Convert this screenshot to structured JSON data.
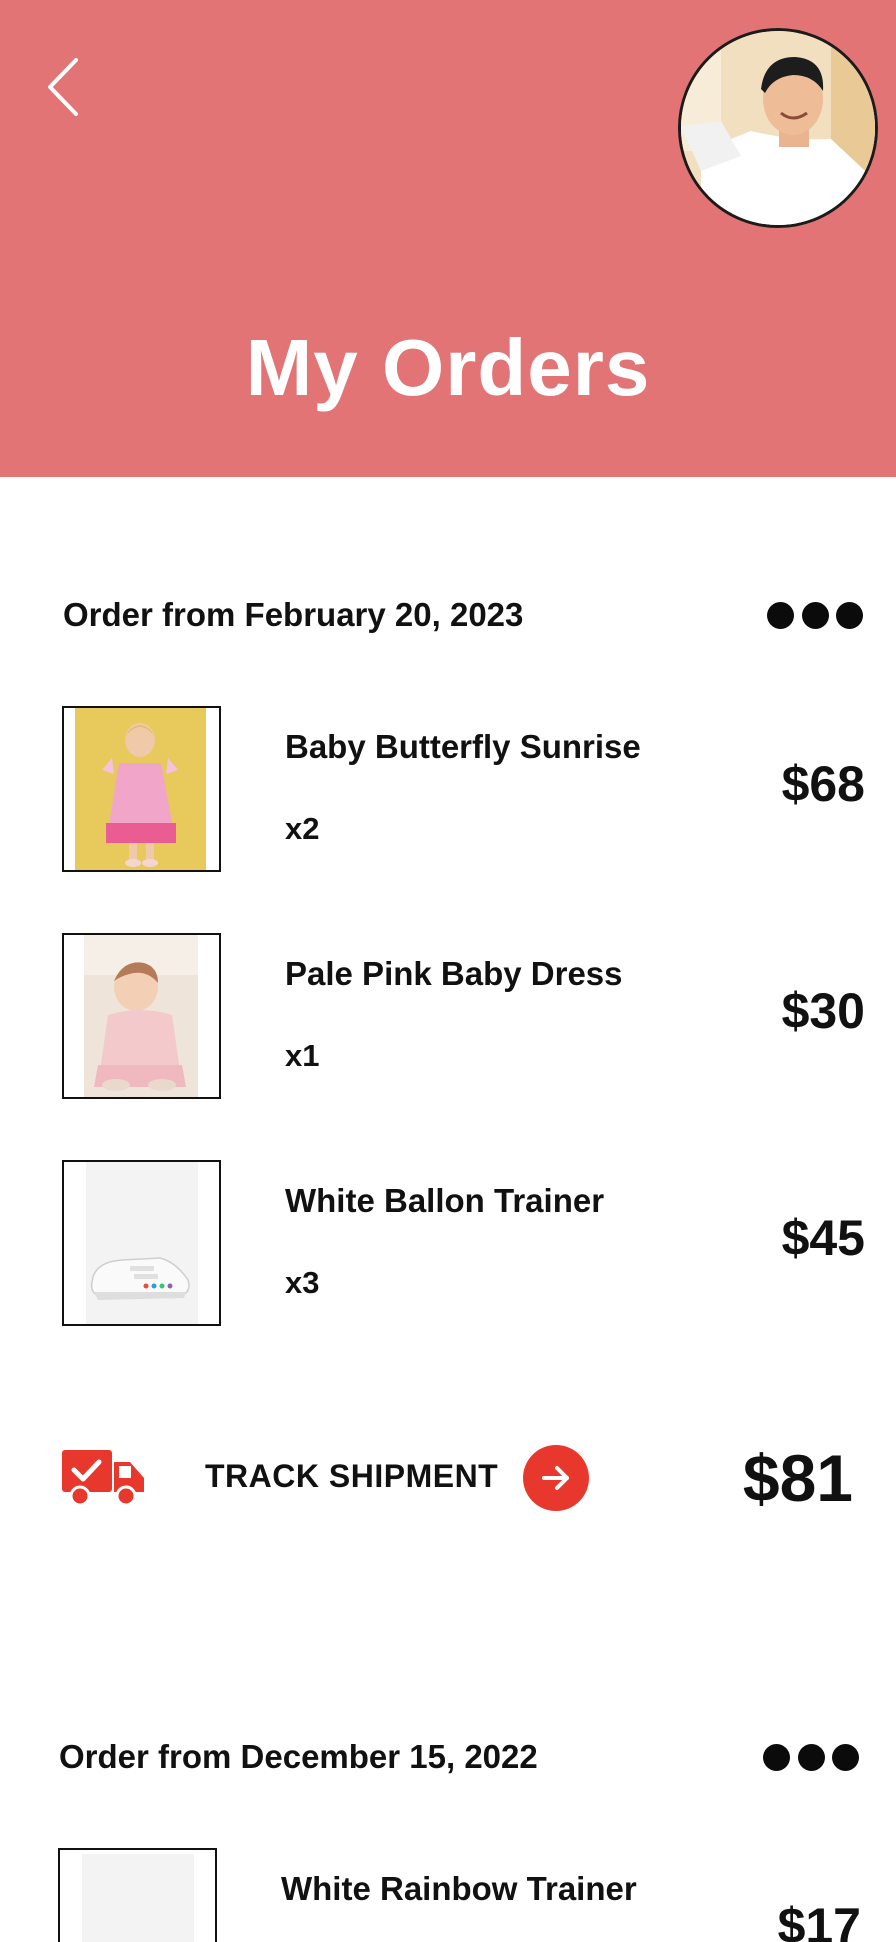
{
  "header": {
    "back_icon": "chevron-left-icon",
    "title": "My Orders",
    "background_color": "#e37475"
  },
  "orders": [
    {
      "date_label": "Order from February 20, 2023",
      "more_icon": "more-dots-icon",
      "items": [
        {
          "name": "Baby Butterfly Sunrise",
          "qty": "x2",
          "price": "$68"
        },
        {
          "name": "Pale Pink Baby Dress",
          "qty": "x1",
          "price": "$30"
        },
        {
          "name": "White Ballon Trainer",
          "qty": "x3",
          "price": "$45"
        }
      ],
      "track": {
        "icon": "delivery-truck-icon",
        "label": "TRACK SHIPMENT",
        "button_icon": "arrow-right-icon"
      },
      "total": "$81"
    },
    {
      "date_label": "Order from December 15, 2022",
      "more_icon": "more-dots-icon",
      "items": [
        {
          "name": "White Rainbow Trainer",
          "price": "$17"
        }
      ]
    }
  ],
  "colors": {
    "accent": "#e8382e",
    "header": "#e37475"
  }
}
